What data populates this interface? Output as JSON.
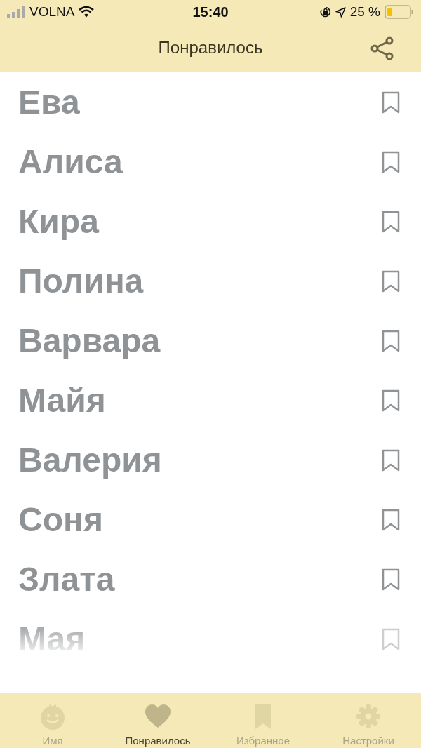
{
  "status_bar": {
    "carrier": "VOLNA",
    "time": "15:40",
    "battery": "25 %"
  },
  "nav_bar": {
    "title": "Понравилось"
  },
  "names": [
    {
      "name": "Ева",
      "bookmarked": false,
      "faded": false
    },
    {
      "name": "Алиса",
      "bookmarked": false,
      "faded": false
    },
    {
      "name": "Кира",
      "bookmarked": false,
      "faded": false
    },
    {
      "name": "Полина",
      "bookmarked": false,
      "faded": false
    },
    {
      "name": "Варвара",
      "bookmarked": false,
      "faded": false
    },
    {
      "name": "Майя",
      "bookmarked": false,
      "faded": false
    },
    {
      "name": "Валерия",
      "bookmarked": false,
      "faded": false
    },
    {
      "name": "Соня",
      "bookmarked": false,
      "faded": false
    },
    {
      "name": "Злата",
      "bookmarked": false,
      "faded": false
    },
    {
      "name": "Мая",
      "bookmarked": false,
      "faded": true
    }
  ],
  "tabs": [
    {
      "label": "Имя",
      "kind": "baby",
      "selected": false
    },
    {
      "label": "Понравилось",
      "kind": "heart",
      "selected": true
    },
    {
      "label": "Избранное",
      "kind": "bookmark",
      "selected": false
    },
    {
      "label": "Настройки",
      "kind": "gear",
      "selected": false
    }
  ]
}
